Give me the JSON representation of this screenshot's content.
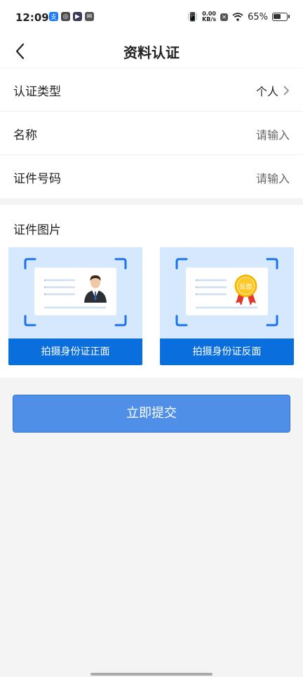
{
  "status": {
    "time": "12:09",
    "net_speed_value": "0.00",
    "net_speed_unit": "KB/s",
    "battery": "65%",
    "battery_level": 0.65
  },
  "nav": {
    "title": "资料认证"
  },
  "form": {
    "rows": [
      {
        "label": "认证类型",
        "value": "个人"
      },
      {
        "label": "名称",
        "value": "请输入"
      },
      {
        "label": "证件号码",
        "value": "请输入"
      }
    ]
  },
  "photos": {
    "title": "证件图片",
    "front_label": "拍摄身份证正面",
    "back_label": "拍摄身份证反面",
    "badge_text": "反面"
  },
  "submit_label": "立即提交",
  "colors": {
    "accent": "#4f8fe8",
    "upload_bg": "#d6e8fd",
    "upload_label_bg": "#0a6fdd"
  }
}
